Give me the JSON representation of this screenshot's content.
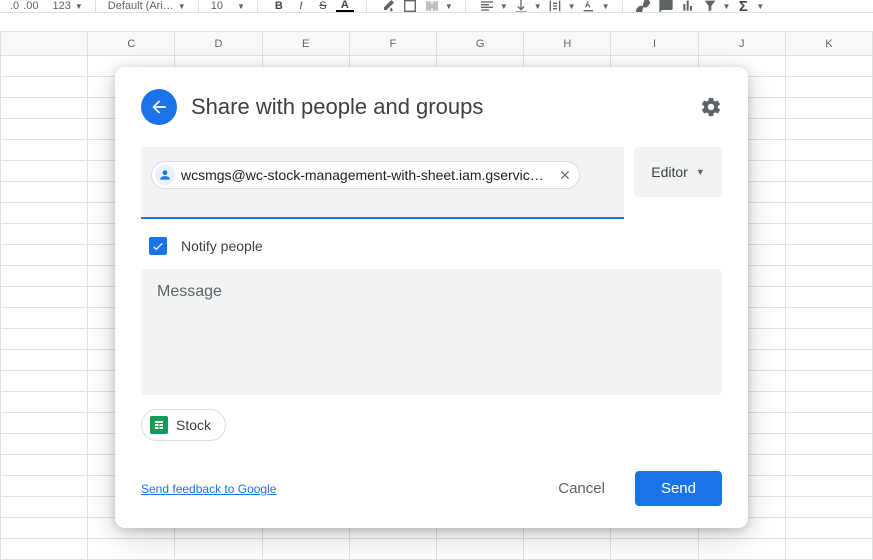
{
  "toolbar": {
    "decimals": ".00",
    "format_btn": "123",
    "font_name": "Default (Ari…",
    "font_size": "10"
  },
  "columns": [
    "",
    "C",
    "D",
    "E",
    "F",
    "G",
    "H",
    "I",
    "J",
    "K"
  ],
  "dialog": {
    "title": "Share with people and groups",
    "chip_email": "wcsmgs@wc-stock-management-with-sheet.iam.gserviceac…",
    "role_label": "Editor",
    "notify_label": "Notify people",
    "message_placeholder": "Message",
    "attachment_name": "Stock",
    "feedback_label": "Send feedback to Google",
    "cancel_label": "Cancel",
    "send_label": "Send"
  }
}
